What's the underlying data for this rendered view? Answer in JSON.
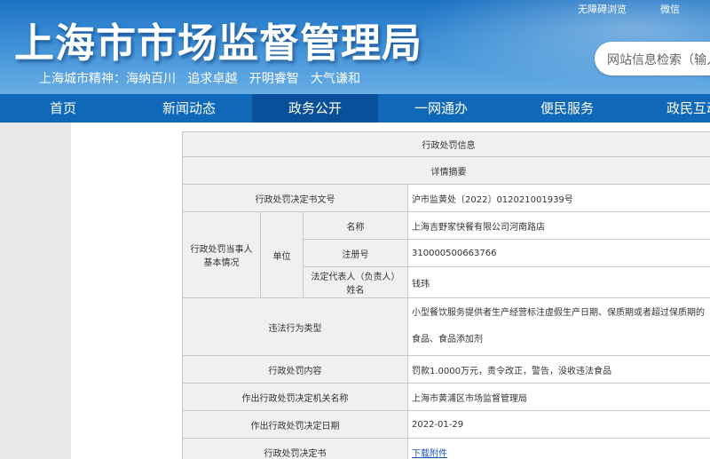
{
  "header": {
    "title": "上海市市场监督管理局",
    "slogan": "上海城市精神：海纳百川   追求卓越   开明睿智   大气谦和",
    "links": [
      "无障碍浏览",
      "微信"
    ],
    "search_placeholder": "网站信息检索（输入"
  },
  "nav": [
    "首页",
    "新闻动态",
    "政务公开",
    "一网通办",
    "便民服务",
    "政民互动"
  ],
  "nav_active": "政务公开",
  "table": {
    "title": "行政处罚信息",
    "subtitle": "详情摘要",
    "decision_no_label": "行政处罚决定书文号",
    "decision_no": "沪市监黄处〔2022〕012021001939号",
    "party_label": "行政处罚当事人基本情况",
    "unit_label": "单位",
    "name_label": "名称",
    "name": "上海吉野家快餐有限公司河南路店",
    "reg_label": "注册号",
    "reg_no": "310000500663766",
    "rep_label": "法定代表人（负责人）姓名",
    "rep": "钱玮",
    "violation_label": "违法行为类型",
    "violation": "小型餐饮服务提供者生产经营标注虚假生产日期、保质期或者超过保质期的食品、食品添加剂",
    "content_label": "行政处罚内容",
    "content": "罚款1.0000万元，责令改正，警告，没收违法食品",
    "authority_label": "作出行政处罚决定机关名称",
    "authority": "上海市黄浦区市场监督管理局",
    "date_label": "作出行政处罚决定日期",
    "date": "2022-01-29",
    "doc_label": "行政处罚决定书",
    "doc_link": "下载附件"
  }
}
